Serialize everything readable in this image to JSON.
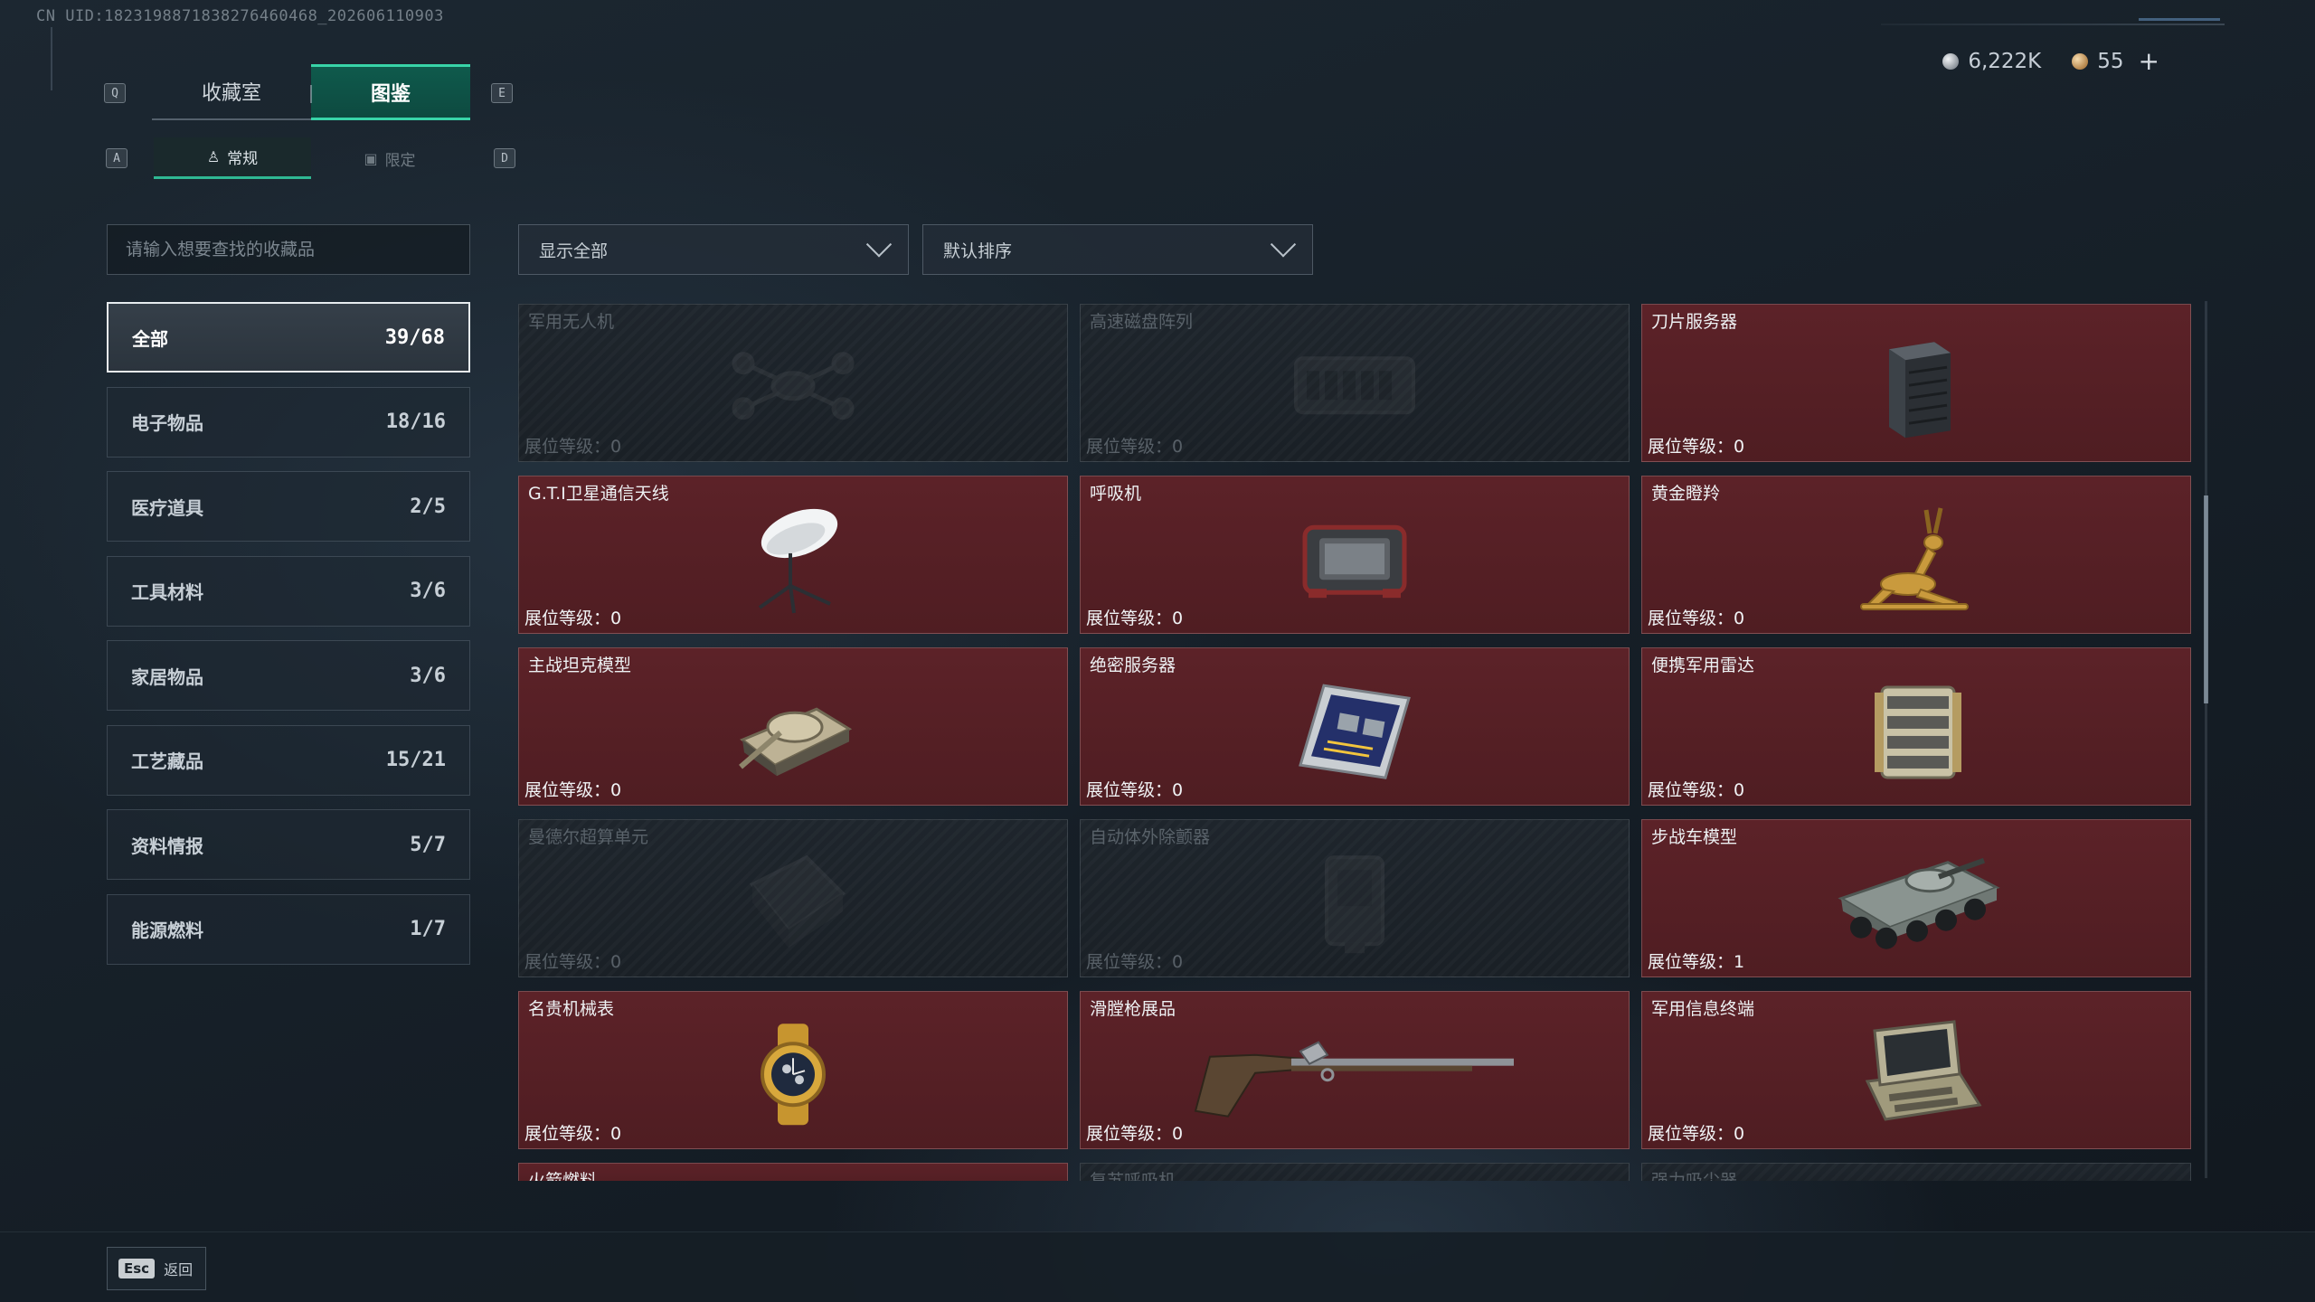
{
  "uid": "CN UID:1823198871838276460468_202606110903",
  "currency": {
    "silver": "6,222K",
    "gold": "55",
    "plus": "+"
  },
  "keys": {
    "prev_tab": "Q",
    "next_tab": "E",
    "prev_sub": "A",
    "next_sub": "D",
    "esc": "Esc"
  },
  "tabs": [
    {
      "label": "收藏室"
    },
    {
      "label": "图鉴"
    }
  ],
  "subtabs": [
    {
      "label": "常规",
      "icon": "person-icon"
    },
    {
      "label": "限定",
      "icon": "image-icon"
    }
  ],
  "search": {
    "placeholder": "请输入想要查找的收藏品"
  },
  "filters": {
    "show": "显示全部",
    "sort": "默认排序"
  },
  "categories": [
    {
      "label": "全部",
      "count": "39/68"
    },
    {
      "label": "电子物品",
      "count": "18/16"
    },
    {
      "label": "医疗道具",
      "count": "2/5"
    },
    {
      "label": "工具材料",
      "count": "3/6"
    },
    {
      "label": "家居物品",
      "count": "3/6"
    },
    {
      "label": "工艺藏品",
      "count": "15/21"
    },
    {
      "label": "资料情报",
      "count": "5/7"
    },
    {
      "label": "能源燃料",
      "count": "1/7"
    }
  ],
  "level_label": "展位等级：",
  "items": [
    {
      "name": "军用无人机",
      "level": "0",
      "owned": false,
      "icon": "drone-icon"
    },
    {
      "name": "高速磁盘阵列",
      "level": "0",
      "owned": false,
      "icon": "disk-array-icon"
    },
    {
      "name": "刀片服务器",
      "level": "0",
      "owned": true,
      "icon": "blade-server-icon"
    },
    {
      "name": "G.T.I卫星通信天线",
      "level": "0",
      "owned": true,
      "icon": "satellite-dish-icon"
    },
    {
      "name": "呼吸机",
      "level": "0",
      "owned": true,
      "icon": "ventilator-icon"
    },
    {
      "name": "黄金瞪羚",
      "level": "0",
      "owned": true,
      "icon": "gazelle-icon"
    },
    {
      "name": "主战坦克模型",
      "level": "0",
      "owned": true,
      "icon": "tank-icon"
    },
    {
      "name": "绝密服务器",
      "level": "0",
      "owned": true,
      "icon": "server-board-icon"
    },
    {
      "name": "便携军用雷达",
      "level": "0",
      "owned": true,
      "icon": "radar-icon"
    },
    {
      "name": "曼德尔超算单元",
      "level": "0",
      "owned": false,
      "icon": "supercomputer-icon"
    },
    {
      "name": "自动体外除颤器",
      "level": "0",
      "owned": false,
      "icon": "defibrillator-icon"
    },
    {
      "name": "步战车模型",
      "level": "1",
      "owned": true,
      "icon": "ifv-icon"
    },
    {
      "name": "名贵机械表",
      "level": "0",
      "owned": true,
      "icon": "watch-icon"
    },
    {
      "name": "滑膛枪展品",
      "level": "0",
      "owned": true,
      "icon": "musket-icon"
    },
    {
      "name": "军用信息终端",
      "level": "0",
      "owned": true,
      "icon": "terminal-icon"
    }
  ],
  "partial_items": [
    {
      "name": "火箭燃料",
      "owned": true
    },
    {
      "name": "复苏呼吸机",
      "owned": false
    },
    {
      "name": "强力吸尘器",
      "owned": false
    }
  ],
  "footer": {
    "back": "返回"
  }
}
